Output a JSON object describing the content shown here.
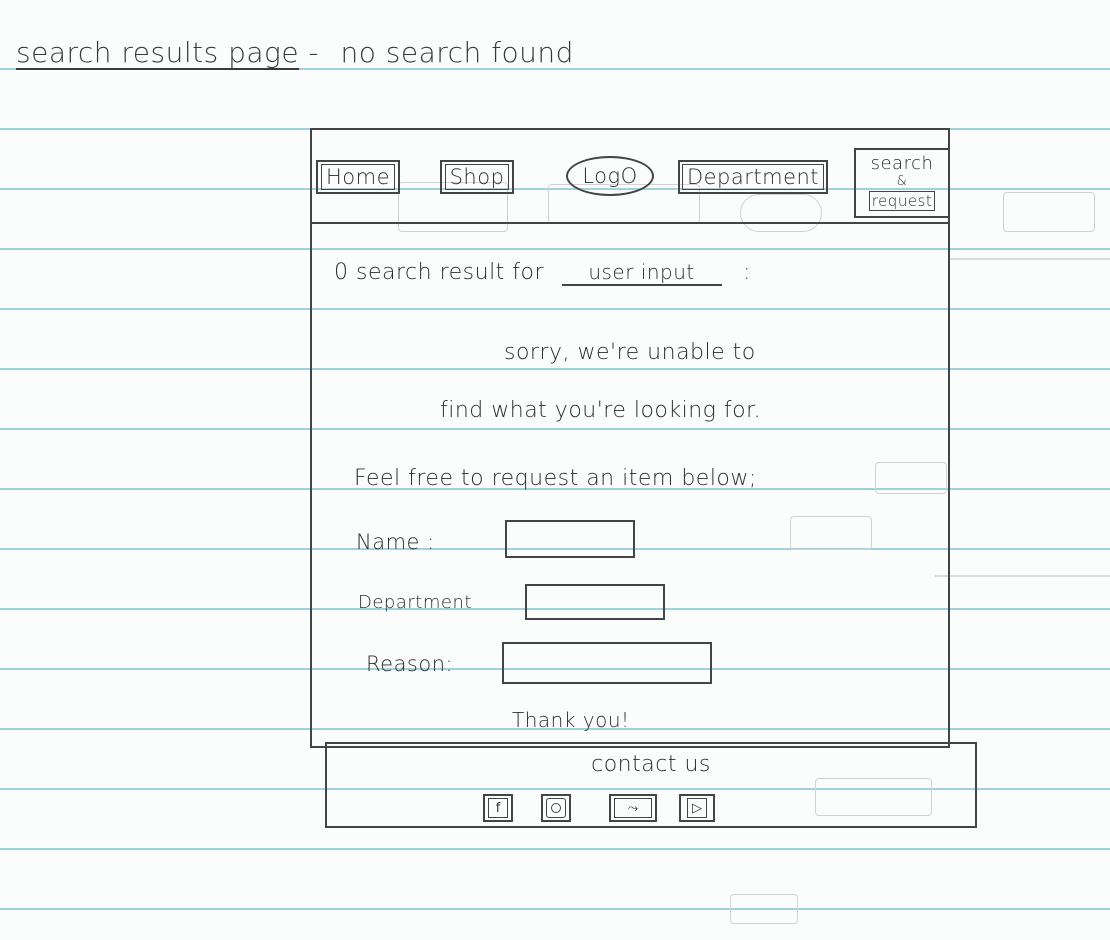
{
  "heading": {
    "title": "search results page",
    "separator": "-",
    "subtitle": "no search found"
  },
  "nav": {
    "home": "Home",
    "shop": "Shop",
    "logo": "LogO",
    "department": "Department",
    "search_line1": "search",
    "search_line2": "&",
    "search_line3": "request"
  },
  "results": {
    "prefix": "0 search result for",
    "query": "user input",
    "suffix": ":"
  },
  "message": {
    "line1": "sorry, we're unable to",
    "line2": "find what you're looking for."
  },
  "form": {
    "intro": "Feel free to request an item below;",
    "name_label": "Name :",
    "department_label": "Department",
    "reason_label": "Reason:",
    "thanks": "Thank you!"
  },
  "footer": {
    "contact": "contact us",
    "icons": [
      "facebook-icon",
      "instagram-icon",
      "twitter-icon",
      "youtube-icon"
    ]
  }
}
